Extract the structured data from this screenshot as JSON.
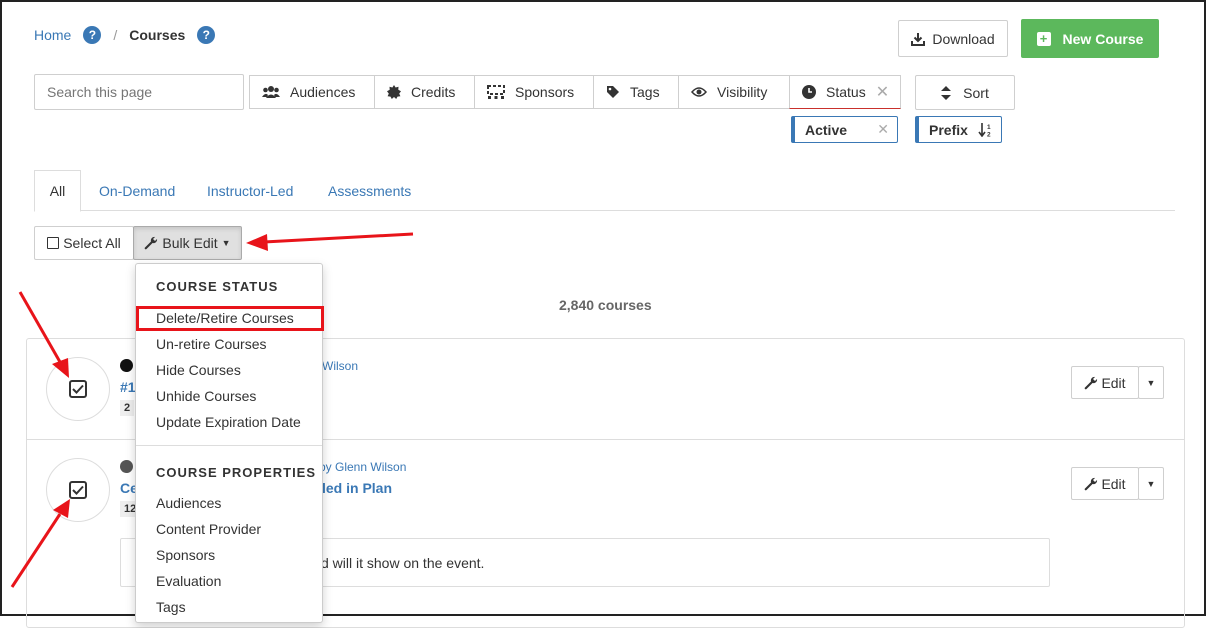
{
  "breadcrumb": {
    "home": "Home",
    "current": "Courses",
    "sep": "/",
    "help": "?"
  },
  "header": {
    "download_label": "Download",
    "new_course_label": "New Course"
  },
  "search": {
    "placeholder": "Search this page"
  },
  "filters": [
    {
      "label": "Audiences",
      "icon": "users-icon"
    },
    {
      "label": "Credits",
      "icon": "badge-icon"
    },
    {
      "label": "Sponsors",
      "icon": "sponsor-icon"
    },
    {
      "label": "Tags",
      "icon": "tag-icon"
    },
    {
      "label": "Visibility",
      "icon": "eye-icon"
    },
    {
      "label": "Status",
      "icon": "clock-icon"
    }
  ],
  "sort": {
    "label": "Sort"
  },
  "chips": {
    "status_value": "Active",
    "sort_value": "Prefix"
  },
  "tabs": [
    "All",
    "On-Demand",
    "Instructor-Led",
    "Assessments"
  ],
  "toolbar": {
    "select_all": "Select All",
    "bulk_edit": "Bulk Edit"
  },
  "count": "2,840 courses",
  "menu": {
    "status_header": "COURSE STATUS",
    "status_items": [
      "Delete/Retire Courses",
      "Un-retire Courses",
      "Hide Courses",
      "Unhide Courses",
      "Update Expiration Date"
    ],
    "properties_header": "COURSE PROPERTIES",
    "property_items": [
      "Audiences",
      "Content Provider",
      "Sponsors",
      "Evaluation",
      "Tags"
    ]
  },
  "courses": [
    {
      "author_fragment": "Wilson",
      "title_fragment": "#1",
      "badge_fragment": "2"
    },
    {
      "author_fragment": "by Glenn Wilson",
      "title_prefix": "Ce",
      "title_fragment": "led in Plan",
      "badge_fragment": "12",
      "note_fragment": "d will it show on the event."
    }
  ],
  "row_actions": {
    "edit_label": "Edit"
  },
  "colors": {
    "accent": "#3a78b5",
    "success": "#5cb85c",
    "annotation": "#e8141a"
  }
}
